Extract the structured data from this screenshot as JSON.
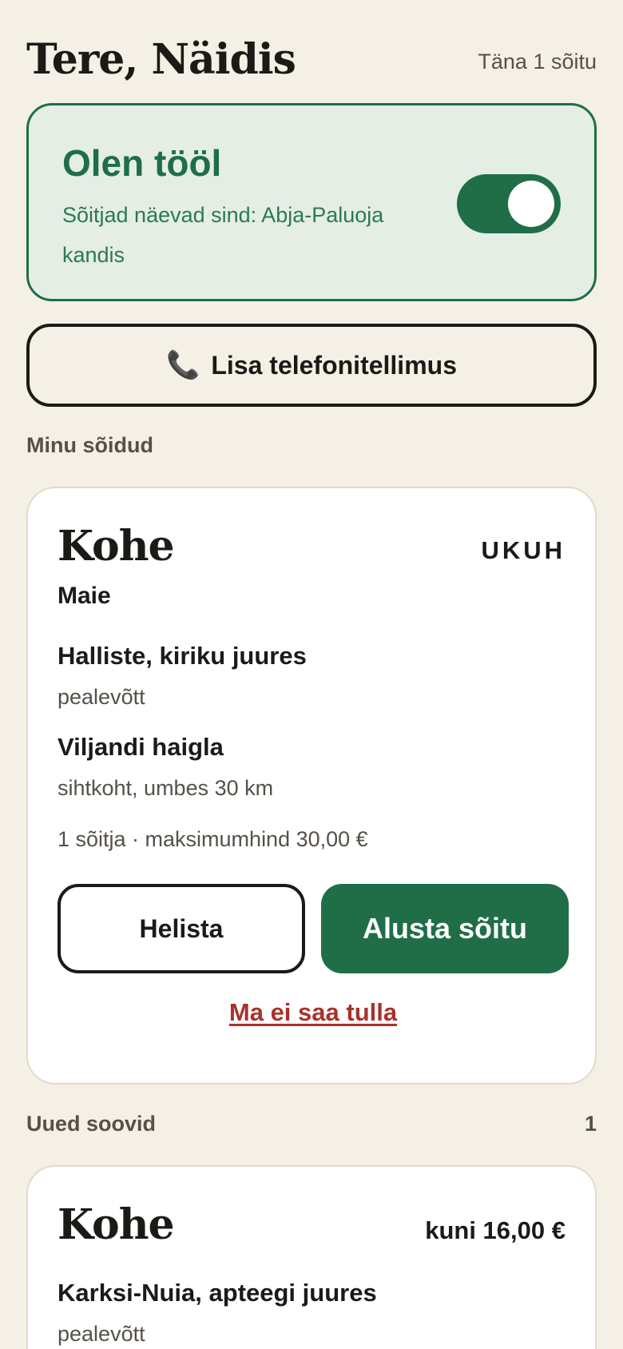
{
  "header": {
    "greeting": "Tere, Näidis",
    "today": "Täna 1 sõitu"
  },
  "work_status": {
    "title": "Olen tööl",
    "subtitle": "Sõitjad näevad sind: Abja-Paluoja kandis",
    "toggle_on": true
  },
  "phone_order": {
    "icon": "📞",
    "label": "Lisa telefonitellimus"
  },
  "my_rides": {
    "section_label": "Minu sõidud",
    "ride": {
      "when": "Kohe",
      "code": "UKUH",
      "rider": "Maie",
      "pickup_name": "Halliste, kiriku juures",
      "pickup_label": "pealevõtt",
      "destination_name": "Viljandi haigla",
      "destination_label": "sihtkoht, umbes 30 km",
      "meta": "1 sõitja · maksimumhind 30,00 €",
      "call_label": "Helista",
      "start_label": "Alusta sõitu",
      "cancel_label": "Ma ei saa tulla"
    }
  },
  "new_requests": {
    "section_label": "Uued soovid",
    "count": "1",
    "request": {
      "when": "Kohe",
      "price": "kuni 16,00 €",
      "pickup_name": "Karksi-Nuia, apteegi juures",
      "pickup_label": "pealevõtt"
    }
  },
  "colors": {
    "background": "#f5f0e6",
    "accent_green": "#1f6e47",
    "active_card_bg": "#e4eee5",
    "danger_red": "#a8322a",
    "text_dark": "#1c1a17",
    "text_muted": "#55504a"
  }
}
